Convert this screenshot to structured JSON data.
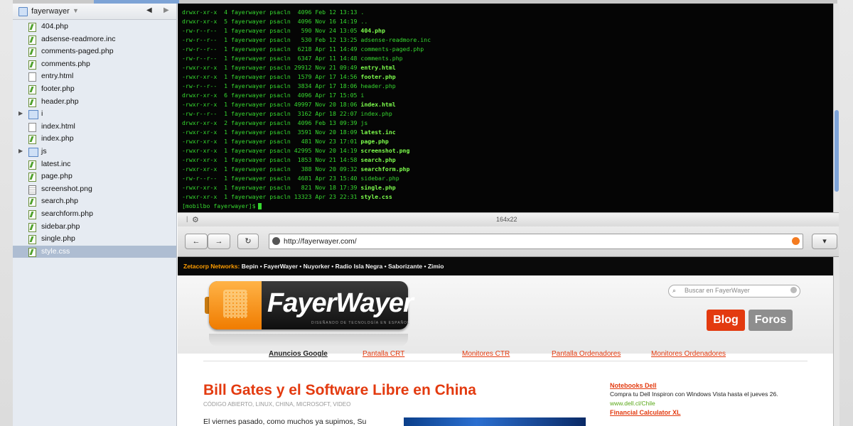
{
  "sidebar": {
    "project": "fayerwayer",
    "files": [
      {
        "name": "404.php",
        "type": "php"
      },
      {
        "name": "adsense-readmore.inc",
        "type": "php"
      },
      {
        "name": "comments-paged.php",
        "type": "php"
      },
      {
        "name": "comments.php",
        "type": "php"
      },
      {
        "name": "entry.html",
        "type": "html"
      },
      {
        "name": "footer.php",
        "type": "php"
      },
      {
        "name": "header.php",
        "type": "php"
      },
      {
        "name": "i",
        "type": "folder"
      },
      {
        "name": "index.html",
        "type": "html"
      },
      {
        "name": "index.php",
        "type": "php"
      },
      {
        "name": "js",
        "type": "folder"
      },
      {
        "name": "latest.inc",
        "type": "php"
      },
      {
        "name": "page.php",
        "type": "php"
      },
      {
        "name": "screenshot.png",
        "type": "png"
      },
      {
        "name": "search.php",
        "type": "php"
      },
      {
        "name": "searchform.php",
        "type": "php"
      },
      {
        "name": "sidebar.php",
        "type": "php"
      },
      {
        "name": "single.php",
        "type": "php"
      },
      {
        "name": "style.css",
        "type": "php",
        "selected": true
      }
    ]
  },
  "terminal": {
    "lines": [
      {
        "perm": "drwxr-xr-x",
        "links": "4",
        "user": "fayerwayer",
        "group": "psacln",
        "size": "4096",
        "date": "Feb 12 13:13",
        "name": ".",
        "hl": false
      },
      {
        "perm": "drwxr-xr-x",
        "links": "5",
        "user": "fayerwayer",
        "group": "psacln",
        "size": "4096",
        "date": "Nov 16 14:19",
        "name": "..",
        "hl": false
      },
      {
        "perm": "-rw-r--r--",
        "links": "1",
        "user": "fayerwayer",
        "group": "psacln",
        "size": "590",
        "date": "Nov 24 13:05",
        "name": "404.php",
        "hl": true
      },
      {
        "perm": "-rw-r--r--",
        "links": "1",
        "user": "fayerwayer",
        "group": "psacln",
        "size": "530",
        "date": "Feb 12 13:25",
        "name": "adsense-readmore.inc",
        "hl": false
      },
      {
        "perm": "-rw-r--r--",
        "links": "1",
        "user": "fayerwayer",
        "group": "psacln",
        "size": "6218",
        "date": "Apr 11 14:49",
        "name": "comments-paged.php",
        "hl": false
      },
      {
        "perm": "-rw-r--r--",
        "links": "1",
        "user": "fayerwayer",
        "group": "psacln",
        "size": "6347",
        "date": "Apr 11 14:48",
        "name": "comments.php",
        "hl": false
      },
      {
        "perm": "-rwxr-xr-x",
        "links": "1",
        "user": "fayerwayer",
        "group": "psacln",
        "size": "29912",
        "date": "Nov 21 09:49",
        "name": "entry.html",
        "hl": true
      },
      {
        "perm": "-rwxr-xr-x",
        "links": "1",
        "user": "fayerwayer",
        "group": "psacln",
        "size": "1579",
        "date": "Apr 17 14:56",
        "name": "footer.php",
        "hl": true
      },
      {
        "perm": "-rw-r--r--",
        "links": "1",
        "user": "fayerwayer",
        "group": "psacln",
        "size": "3834",
        "date": "Apr 17 18:06",
        "name": "header.php",
        "hl": false
      },
      {
        "perm": "drwxr-xr-x",
        "links": "6",
        "user": "fayerwayer",
        "group": "psacln",
        "size": "4096",
        "date": "Apr 17 15:05",
        "name": "i",
        "hl": false
      },
      {
        "perm": "-rwxr-xr-x",
        "links": "1",
        "user": "fayerwayer",
        "group": "psacln",
        "size": "49997",
        "date": "Nov 20 18:06",
        "name": "index.html",
        "hl": true
      },
      {
        "perm": "-rw-r--r--",
        "links": "1",
        "user": "fayerwayer",
        "group": "psacln",
        "size": "3162",
        "date": "Apr 18 22:07",
        "name": "index.php",
        "hl": false
      },
      {
        "perm": "drwxr-xr-x",
        "links": "2",
        "user": "fayerwayer",
        "group": "psacln",
        "size": "4096",
        "date": "Feb 13 09:39",
        "name": "js",
        "hl": false
      },
      {
        "perm": "-rwxr-xr-x",
        "links": "1",
        "user": "fayerwayer",
        "group": "psacln",
        "size": "3591",
        "date": "Nov 20 18:09",
        "name": "latest.inc",
        "hl": true
      },
      {
        "perm": "-rwxr-xr-x",
        "links": "1",
        "user": "fayerwayer",
        "group": "psacln",
        "size": "481",
        "date": "Nov 23 17:01",
        "name": "page.php",
        "hl": true
      },
      {
        "perm": "-rwxr-xr-x",
        "links": "1",
        "user": "fayerwayer",
        "group": "psacln",
        "size": "42995",
        "date": "Nov 20 14:19",
        "name": "screenshot.png",
        "hl": true
      },
      {
        "perm": "-rwxr-xr-x",
        "links": "1",
        "user": "fayerwayer",
        "group": "psacln",
        "size": "1853",
        "date": "Nov 21 14:58",
        "name": "search.php",
        "hl": true
      },
      {
        "perm": "-rwxr-xr-x",
        "links": "1",
        "user": "fayerwayer",
        "group": "psacln",
        "size": "388",
        "date": "Nov 20 09:32",
        "name": "searchform.php",
        "hl": true
      },
      {
        "perm": "-rw-r--r--",
        "links": "1",
        "user": "fayerwayer",
        "group": "psacln",
        "size": "4681",
        "date": "Apr 23 15:40",
        "name": "sidebar.php",
        "hl": false
      },
      {
        "perm": "-rwxr-xr-x",
        "links": "1",
        "user": "fayerwayer",
        "group": "psacln",
        "size": "821",
        "date": "Nov 18 17:39",
        "name": "single.php",
        "hl": true
      },
      {
        "perm": "-rwxr-xr-x",
        "links": "1",
        "user": "fayerwayer",
        "group": "psacln",
        "size": "13323",
        "date": "Apr 23 22:31",
        "name": "style.css",
        "hl": true
      }
    ],
    "prompt": "[mobilbo fayerwayer]$",
    "dimensions": "164x22"
  },
  "browser": {
    "url": "http://fayerwayer.com/",
    "back_label": "←",
    "fwd_label": "→",
    "reload_label": "↻",
    "menu_label": "▾"
  },
  "web": {
    "networks_label": "Zetacorp Networks:",
    "networks_links": "Bepin • FayerWayer • Nuyorker • Radio Isla Negra • Saborizante • Zimio",
    "logo": "FayerWayer",
    "logo_sub": "DISEÑANDO DE TECNOLOGÍA EN ESPAÑOL",
    "search_placeholder": "Buscar en FayerWayer",
    "tab_blog": "Blog",
    "tab_foros": "Foros",
    "ads_head": "Anuncios Google",
    "ads": [
      "Pantalla CRT",
      "Monitores CTR",
      "Pantalla Ordenadores",
      "Monitores Ordenadores"
    ],
    "article_title": "Bill Gates y el Software Libre en China",
    "article_tags": "CÓDIGO ABIERTO, LINUX, CHINA, MICROSOFT, VIDEO",
    "article_body": "El viernes pasado, como muchos ya supimos, Su",
    "side_ad_title": "Notebooks Dell",
    "side_ad_desc": "Compra tu Dell Inspiron con Windows Vista hasta el jueves 26.",
    "side_ad_url": "www.dell.cl/Chile",
    "side_ad_title2": "Financial Calculator XL"
  }
}
